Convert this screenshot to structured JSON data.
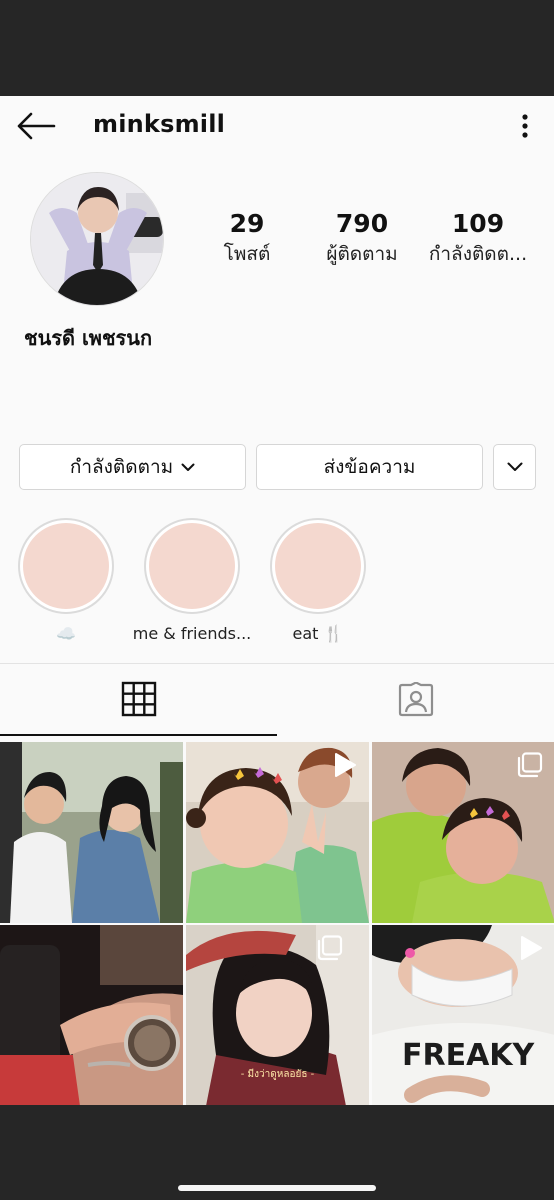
{
  "header": {
    "username": "minksmill",
    "back_icon": "arrow-left-icon",
    "more_icon": "more-vertical-icon"
  },
  "profile": {
    "display_name": "ชนรดี เพชรนก",
    "stats": {
      "posts_count": "29",
      "posts_label": "โพสต์",
      "followers_count": "790",
      "followers_label": "ผู้ติดตาม",
      "following_count": "109",
      "following_label": "กำลังติดต..."
    }
  },
  "actions": {
    "following_label": "กำลังติดตาม",
    "message_label": "ส่งข้อความ"
  },
  "highlights": [
    {
      "label": "☁️",
      "color": "#f4d8cf"
    },
    {
      "label": "me & friends...",
      "color": "#f4d8cf"
    },
    {
      "label": "eat 🍴",
      "color": "#f4d8cf"
    }
  ],
  "tabs": [
    {
      "name": "posts-grid",
      "icon": "grid-icon",
      "active": true
    },
    {
      "name": "tagged",
      "icon": "tagged-person-icon",
      "active": false
    }
  ],
  "posts": [
    {
      "type": "photo"
    },
    {
      "type": "video",
      "icon": "play-icon"
    },
    {
      "type": "carousel",
      "icon": "carousel-icon"
    },
    {
      "type": "photo"
    },
    {
      "type": "carousel",
      "icon": "carousel-icon",
      "caption": "- มีงว่าดูหลอยัธ -"
    },
    {
      "type": "video",
      "icon": "play-icon"
    }
  ],
  "colors": {
    "background": "#fafafa",
    "text": "#111111",
    "border": "#d6d6d6",
    "highlight_fill": "#f4d8cf",
    "system_bar": "#262626"
  }
}
